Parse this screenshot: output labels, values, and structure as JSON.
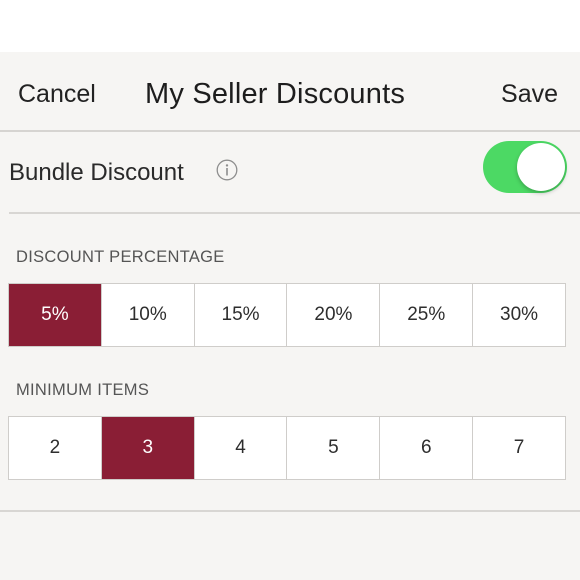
{
  "nav": {
    "cancel": "Cancel",
    "title": "My Seller Discounts",
    "save": "Save"
  },
  "bundle": {
    "label": "Bundle Discount",
    "info_icon": "info-circle-icon",
    "enabled": true
  },
  "discount_percentage": {
    "label": "DISCOUNT PERCENTAGE",
    "options": [
      "5%",
      "10%",
      "15%",
      "20%",
      "25%",
      "30%"
    ],
    "selected": "5%"
  },
  "minimum_items": {
    "label": "MINIMUM ITEMS",
    "options": [
      "2",
      "3",
      "4",
      "5",
      "6",
      "7"
    ],
    "selected": "3"
  },
  "colors": {
    "accent": "#8a1e35",
    "toggle_on": "#4cd964",
    "background": "#f6f5f3"
  }
}
